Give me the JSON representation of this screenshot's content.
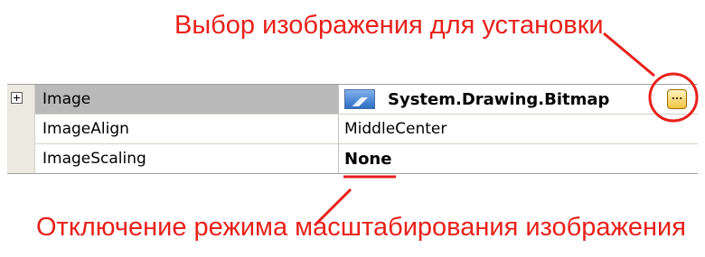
{
  "annotations": {
    "top": "Выбор изображения для установки",
    "bottom": "Отключение режима масштабирования изображения"
  },
  "property_grid": {
    "rows": [
      {
        "name": "Image",
        "value": "System.Drawing.Bitmap",
        "expandable": true,
        "selected": true,
        "value_bold": true,
        "has_value_icon": true,
        "value_icon": "bitmap-icon",
        "has_ellipsis_button": true,
        "ellipsis_label": "..."
      },
      {
        "name": "ImageAlign",
        "value": "MiddleCenter",
        "expandable": false,
        "selected": false,
        "value_bold": false
      },
      {
        "name": "ImageScaling",
        "value": "None",
        "expandable": false,
        "selected": false,
        "value_bold": true
      }
    ]
  },
  "colors": {
    "annotation": "#e8201a",
    "selected_row": "#b9b9b9",
    "gutter": "#eceae0"
  }
}
